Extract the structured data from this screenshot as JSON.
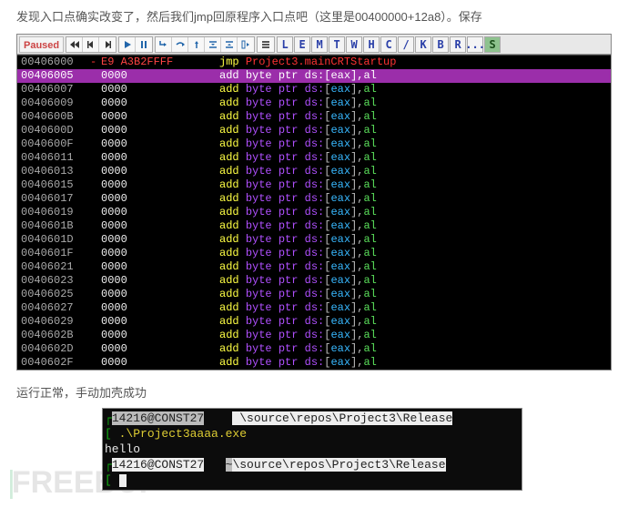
{
  "text1": "发现入口点确实改变了，然后我们jmp回原程序入口点吧（这里是00400000+12a8）。保存",
  "text2": "运行正常，手动加壳成功",
  "toolbar": {
    "paused": "Paused",
    "letters": [
      "L",
      "E",
      "M",
      "T",
      "W",
      "H",
      "C",
      "/",
      "K",
      "B",
      "R",
      "...",
      "S"
    ]
  },
  "disasm": {
    "firstRow": {
      "addr": "00406000",
      "eip": "-",
      "bytes": "E9 A3B2FFFF",
      "mn": "jmp",
      "target": "Project3.mainCRTStartup"
    },
    "selected": 1,
    "rows": [
      {
        "addr": "00406005",
        "bytes": "0000"
      },
      {
        "addr": "00406007",
        "bytes": "0000"
      },
      {
        "addr": "00406009",
        "bytes": "0000"
      },
      {
        "addr": "0040600B",
        "bytes": "0000"
      },
      {
        "addr": "0040600D",
        "bytes": "0000"
      },
      {
        "addr": "0040600F",
        "bytes": "0000"
      },
      {
        "addr": "00406011",
        "bytes": "0000"
      },
      {
        "addr": "00406013",
        "bytes": "0000"
      },
      {
        "addr": "00406015",
        "bytes": "0000"
      },
      {
        "addr": "00406017",
        "bytes": "0000"
      },
      {
        "addr": "00406019",
        "bytes": "0000"
      },
      {
        "addr": "0040601B",
        "bytes": "0000"
      },
      {
        "addr": "0040601D",
        "bytes": "0000"
      },
      {
        "addr": "0040601F",
        "bytes": "0000"
      },
      {
        "addr": "00406021",
        "bytes": "0000"
      },
      {
        "addr": "00406023",
        "bytes": "0000"
      },
      {
        "addr": "00406025",
        "bytes": "0000"
      },
      {
        "addr": "00406027",
        "bytes": "0000"
      },
      {
        "addr": "00406029",
        "bytes": "0000"
      },
      {
        "addr": "0040602B",
        "bytes": "0000"
      },
      {
        "addr": "0040602D",
        "bytes": "0000"
      },
      {
        "addr": "0040602F",
        "bytes": "0000"
      }
    ],
    "addLine": {
      "mn": "add",
      "kw1": "byte",
      "kw2": "ptr",
      "seg": "ds:",
      "reg": "eax",
      "imm": "al"
    }
  },
  "console": {
    "line1_left": "14216@CONST27",
    "line1_right": " \\source\\repos\\Project3\\Release",
    "prompt": "[ ",
    "cmd": ".\\Project3aaaa.exe",
    "out": "hello",
    "line4_left": "14216@CONST27",
    "line4_tilde": "~",
    "line4_right": "\\source\\repos\\Project3\\Release",
    "prompt2": "[ "
  },
  "watermark": "FREEBUF"
}
